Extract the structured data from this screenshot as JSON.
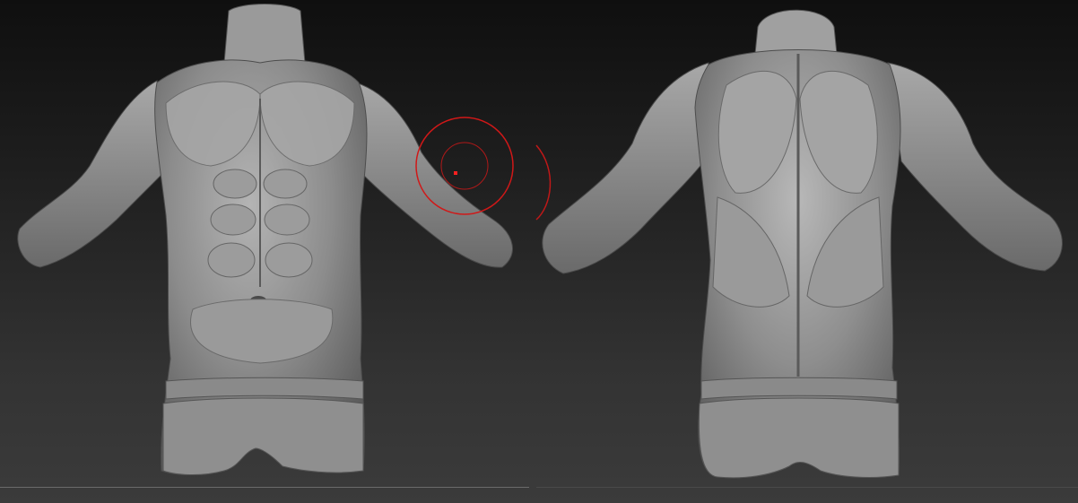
{
  "viewport": {
    "background_top": "#0f0f0f",
    "background_bottom": "#3b3b3b",
    "model_color": "#8e8e8e"
  },
  "models": [
    {
      "name": "torso-front-view"
    },
    {
      "name": "torso-back-view"
    }
  ],
  "brush_cursor": {
    "ring_color": "#d01818",
    "center_dot_color": "#ff2020"
  }
}
